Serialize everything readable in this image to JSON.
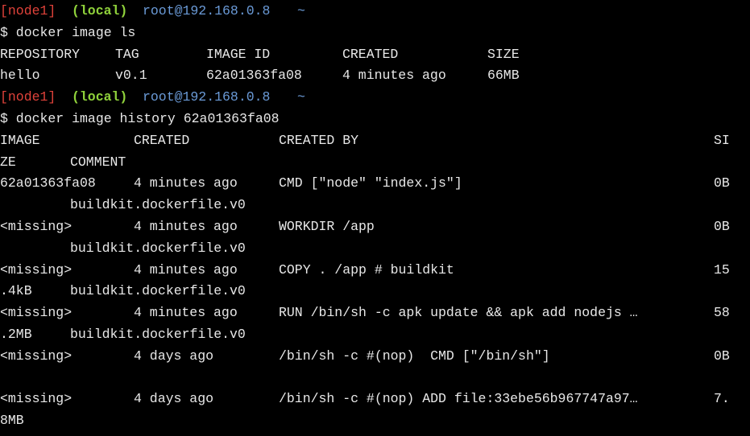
{
  "prompt": {
    "node": "[node1]",
    "local": "(local)",
    "host": "root@192.168.0.8",
    "path": "~"
  },
  "commands": {
    "ls": "$ docker image ls",
    "history": "$ docker image history 62a01363fa08"
  },
  "image_ls": {
    "headers": [
      "REPOSITORY",
      "TAG",
      "IMAGE ID",
      "CREATED",
      "SIZE"
    ],
    "rows": [
      {
        "repository": "hello",
        "tag": "v0.1",
        "image_id": "62a01363fa08",
        "created": "4 minutes ago",
        "size": "66MB"
      }
    ]
  },
  "history": {
    "headers": {
      "image": "IMAGE",
      "created": "CREATED",
      "created_by": "CREATED BY",
      "size_part1": "SI",
      "size_part2": "ZE",
      "comment": "COMMENT"
    },
    "rows": [
      {
        "image": "62a01363fa08",
        "created": "4 minutes ago",
        "created_by": "CMD [\"node\" \"index.js\"]",
        "size_a": "0B",
        "size_b": "",
        "comment": "buildkit.dockerfile.v0"
      },
      {
        "image": "<missing>",
        "created": "4 minutes ago",
        "created_by": "WORKDIR /app",
        "size_a": "0B",
        "size_b": "",
        "comment": "buildkit.dockerfile.v0"
      },
      {
        "image": "<missing>",
        "created": "4 minutes ago",
        "created_by": "COPY . /app # buildkit",
        "size_a": "15",
        "size_b": ".4kB",
        "comment": "buildkit.dockerfile.v0"
      },
      {
        "image": "<missing>",
        "created": "4 minutes ago",
        "created_by": "RUN /bin/sh -c apk update && apk add nodejs …",
        "size_a": "58",
        "size_b": ".2MB",
        "comment": "buildkit.dockerfile.v0"
      },
      {
        "image": "<missing>",
        "created": "4 days ago",
        "created_by": "/bin/sh -c #(nop)  CMD [\"/bin/sh\"]",
        "size_a": "0B",
        "size_b": "",
        "comment": ""
      },
      {
        "image": "<missing>",
        "created": "4 days ago",
        "created_by": "/bin/sh -c #(nop) ADD file:33ebe56b967747a97…",
        "size_a": "7.",
        "size_b": "8MB",
        "comment": ""
      }
    ]
  },
  "colors": {
    "background": "#000000",
    "foreground": "#e8e8e8",
    "node": "#e0423a",
    "local": "#8fd13b",
    "host": "#6b9bd8"
  }
}
